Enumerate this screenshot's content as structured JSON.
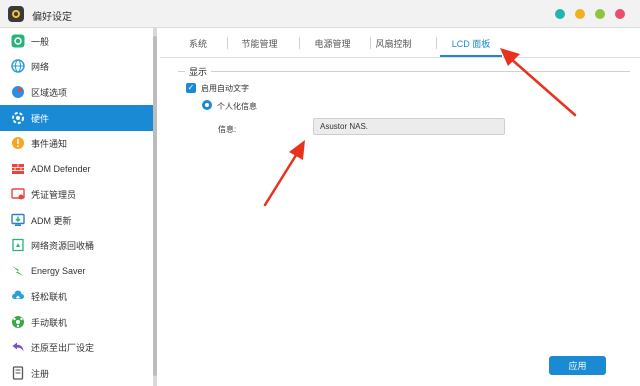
{
  "window": {
    "title": "偏好设定",
    "controls": [
      {
        "name": "close",
        "color": "#1fb5b0"
      },
      {
        "name": "minimize",
        "color": "#f2b01e"
      },
      {
        "name": "maximize",
        "color": "#8cc63f"
      },
      {
        "name": "extra",
        "color": "#e84d6b"
      }
    ]
  },
  "sidebar": {
    "items": [
      {
        "label": "一般",
        "icon": "general-icon",
        "color": "#2ab27b"
      },
      {
        "label": "网络",
        "icon": "network-globe-icon",
        "color": "#1f9bd7"
      },
      {
        "label": "区域选项",
        "icon": "region-icon",
        "color": "#2e8fe0"
      },
      {
        "label": "硬件",
        "icon": "hardware-icon",
        "color": "#ffffff",
        "active": true
      },
      {
        "label": "事件通知",
        "icon": "notification-icon",
        "color": "#f5a623"
      },
      {
        "label": "ADM Defender",
        "icon": "defender-icon",
        "color": "#e8453c"
      },
      {
        "label": "凭证管理员",
        "icon": "certificate-icon",
        "color": "#e8453c"
      },
      {
        "label": "ADM 更新",
        "icon": "update-icon",
        "color": "#2a7fc7"
      },
      {
        "label": "网络资源回收桶",
        "icon": "recycle-bin-icon",
        "color": "#2ab27b"
      },
      {
        "label": "Energy Saver",
        "icon": "energy-saver-icon",
        "color": "#3aa84a"
      },
      {
        "label": "轻松联机",
        "icon": "cloud-connect-icon",
        "color": "#2a9fd8"
      },
      {
        "label": "手动联机",
        "icon": "manual-connect-icon",
        "color": "#3aa84a"
      },
      {
        "label": "还原至出厂设定",
        "icon": "restore-icon",
        "color": "#7b4fc4"
      },
      {
        "label": "注册",
        "icon": "register-icon",
        "color": "#555555"
      }
    ]
  },
  "tabs": [
    {
      "label": "系统"
    },
    {
      "label": "节能管理"
    },
    {
      "label": "电源管理"
    },
    {
      "label": "风扇控制"
    },
    {
      "label": "LCD 面板",
      "active": true
    }
  ],
  "panel": {
    "section_title": "显示",
    "checkbox_label": "启用自动文字",
    "checkbox_checked": true,
    "radio_label": "个人化信息",
    "info_label": "信息:",
    "info_value": "Asustor NAS.",
    "apply_label": "应用"
  },
  "colors": {
    "accent": "#1a8ad4",
    "annotation_arrow": "#e8321e"
  }
}
